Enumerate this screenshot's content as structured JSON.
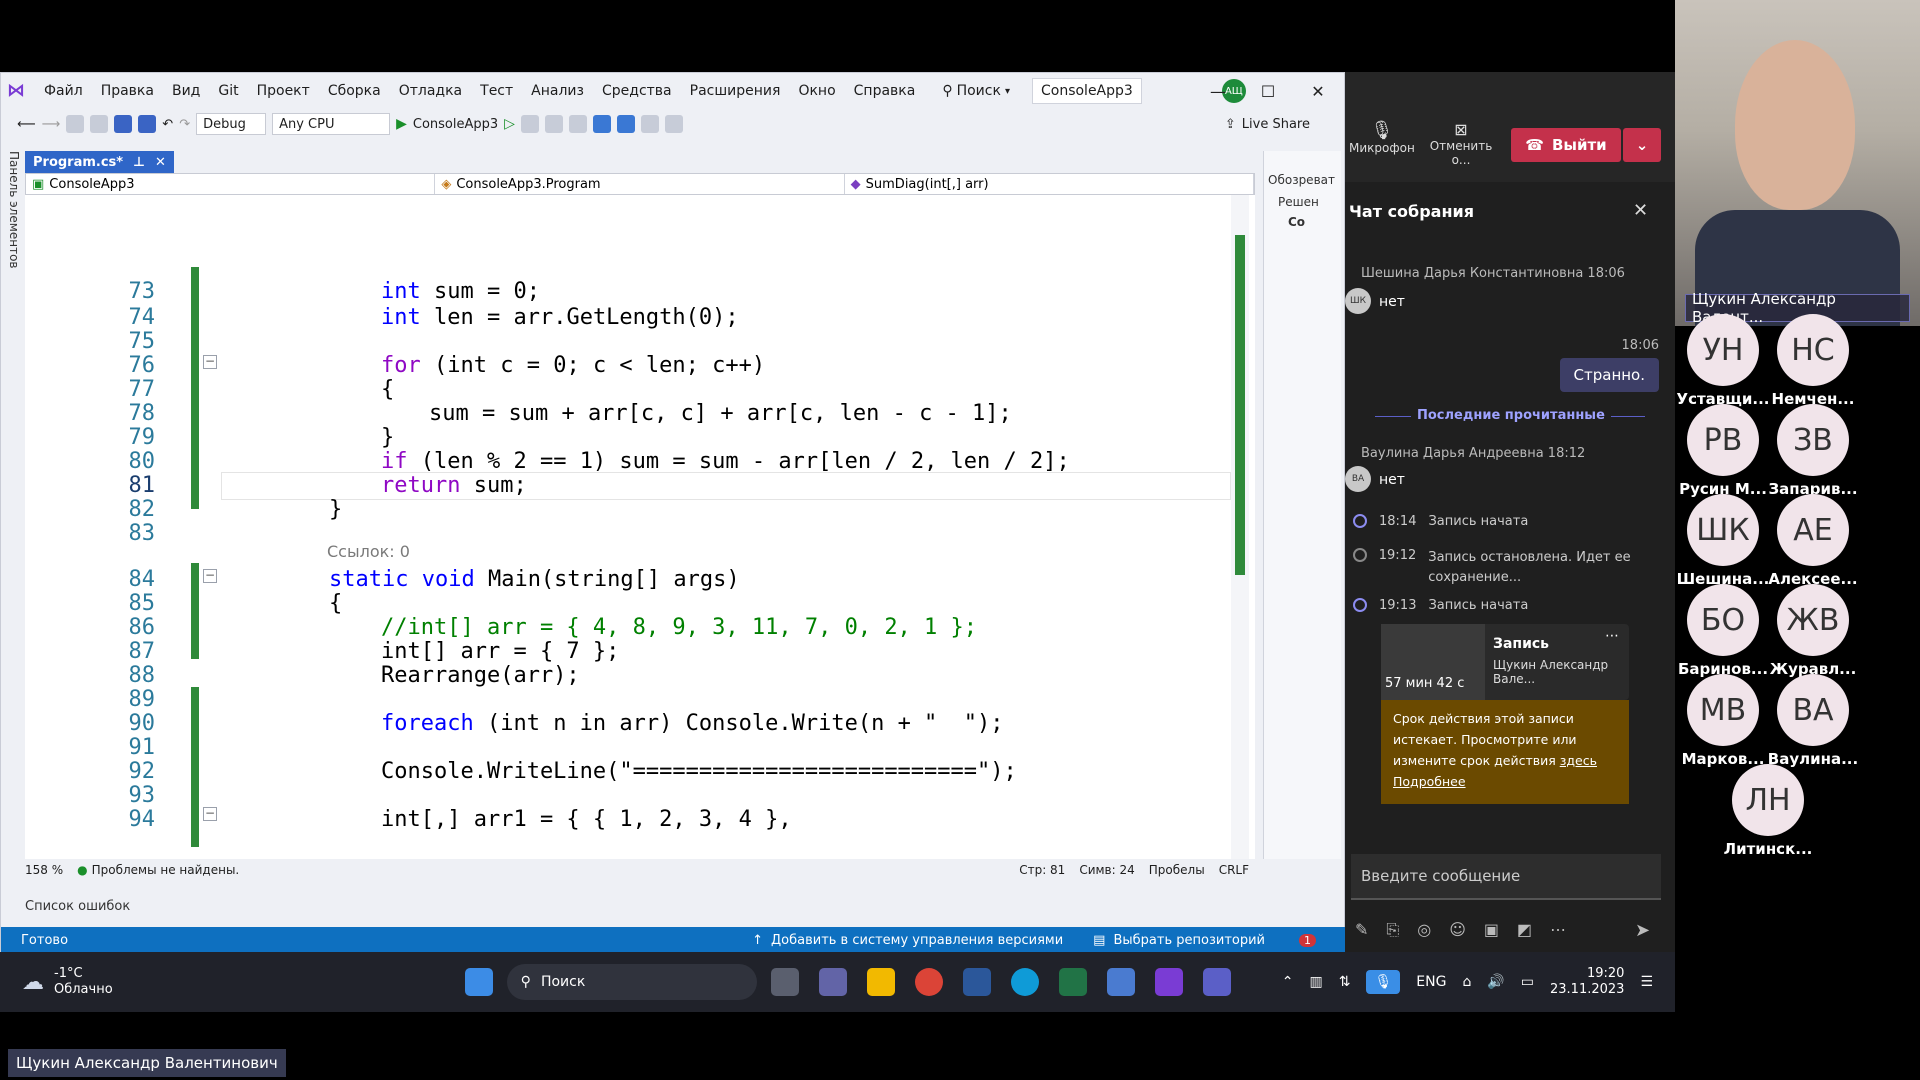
{
  "vs": {
    "menu": [
      "Файл",
      "Правка",
      "Вид",
      "Git",
      "Проект",
      "Сборка",
      "Отладка",
      "Тест",
      "Анализ",
      "Средства",
      "Расширения",
      "Окно",
      "Справка"
    ],
    "search_label": "Поиск",
    "solution_title": "ConsoleApp3",
    "user_initials": "АЩ",
    "toolbar": {
      "config": "Debug",
      "platform": "Any CPU",
      "start_target": "ConsoleApp3",
      "live_share": "Live Share"
    },
    "tab": {
      "title": "Program.cs*"
    },
    "nav": {
      "project": "ConsoleApp3",
      "class": "ConsoleApp3.Program",
      "member": "SumDiag(int[,] arr)"
    },
    "left_strip": "Панель элементов",
    "side_panel": {
      "title": "Обозреват",
      "item1": "Решен",
      "item2": "Co"
    },
    "line_numbers": [
      "73",
      "74",
      "75",
      "76",
      "77",
      "78",
      "79",
      "80",
      "81",
      "82",
      "83",
      "84",
      "85",
      "86",
      "87",
      "88",
      "89",
      "90",
      "91",
      "92",
      "93",
      "94"
    ],
    "codelens": "Ссылок: 0",
    "code_lines": [
      "int sum = 0;",
      "int len = arr.GetLength(0);",
      "",
      "for (int c = 0; c < len; c++)",
      "{",
      "sum = sum + arr[c, c] + arr[c, len - c - 1];",
      "}",
      "if (len % 2 == 1) sum = sum - arr[len / 2, len / 2];",
      "return sum;",
      "}",
      "",
      "static void Main(string[] args)",
      "{",
      "//int[] arr = { 4, 8, 9, 3, 11, 7, 0, 2, 1 };",
      "int[] arr = { 7 };",
      "Rearrange(arr);",
      "",
      "foreach (int n in arr) Console.Write(n + \"  \");",
      "",
      "Console.WriteLine(\"==========================\");",
      "",
      "int[,] arr1 = { { 1, 2, 3, 4 },"
    ],
    "status": {
      "zoom": "158 %",
      "problems": "Проблемы не найдены.",
      "line": "Стр: 81",
      "col": "Симв: 24",
      "spaces": "Пробелы",
      "eol": "CRLF"
    },
    "error_list": "Список ошибок",
    "bluebar": {
      "ready": "Готово",
      "add_vcs": "Добавить в систему управления версиями",
      "select_repo": "Выбрать репозиторий",
      "notif": "1"
    }
  },
  "teams": {
    "mic": "Микрофон",
    "cancel": "Отменить о...",
    "leave": "Выйти",
    "chat_title": "Чат собрания",
    "msg1_meta": "Шешина Дарья Константиновна  18:06",
    "msg1_initials": "ШК",
    "msg1_text": "нет",
    "my_time": "18:06",
    "my_text": "Странно.",
    "last_read": "Последние прочитанные",
    "msg2_meta": "Ваулина Дарья Андреевна  18:12",
    "msg2_initials": "ВА",
    "msg2_text": "нет",
    "sys1_time": "18:14",
    "sys1_text": "Запись начата",
    "sys2_time": "19:12",
    "sys2_text": "Запись остановлена. Идет ее сохранение...",
    "sys3_time": "19:13",
    "sys3_text": "Запись начата",
    "rec_title": "Запись",
    "rec_author": "Щукин Александр Вале...",
    "rec_duration": "57 мин 42 с",
    "warn_text": "Срок действия этой записи истекает. Просмотрите или измените срок действия",
    "warn_link1": "здесь",
    "warn_link2": "Подробнее",
    "input_placeholder": "Введите сообщение"
  },
  "people": {
    "cam_name": "Щукин Александр Валент...",
    "list": [
      {
        "initials": "УН",
        "name": "Уставщи..."
      },
      {
        "initials": "НС",
        "name": "Немчен..."
      },
      {
        "initials": "РВ",
        "name": "Русин М..."
      },
      {
        "initials": "ЗВ",
        "name": "Запарив..."
      },
      {
        "initials": "ШК",
        "name": "Шешина..."
      },
      {
        "initials": "АЕ",
        "name": "Алексее..."
      },
      {
        "initials": "БО",
        "name": "Баринов..."
      },
      {
        "initials": "ЖВ",
        "name": "Журавл..."
      },
      {
        "initials": "МВ",
        "name": "Марков..."
      },
      {
        "initials": "ВА",
        "name": "Ваулина..."
      },
      {
        "initials": "ЛН",
        "name": "Литинск..."
      }
    ]
  },
  "taskbar": {
    "temp": "-1°C",
    "weather": "Облачно",
    "search": "Поиск",
    "lang": "ENG",
    "time": "19:20",
    "date": "23.11.2023"
  },
  "presenter_name": "Щукин Александр Валентинович"
}
